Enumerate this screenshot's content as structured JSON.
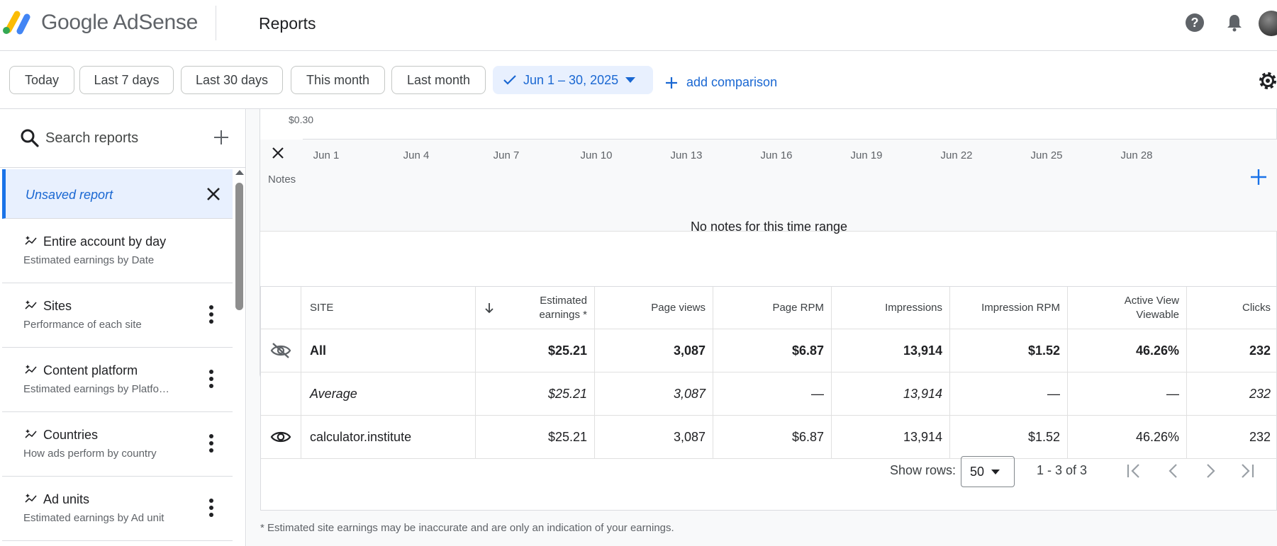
{
  "app": {
    "brand": "Google AdSense",
    "page_title": "Reports"
  },
  "date_chips": [
    "Today",
    "Last 7 days",
    "Last 30 days",
    "This month",
    "Last month"
  ],
  "date_range": {
    "selected_label": "Jun 1 – 30, 2025",
    "add_comparison": "add comparison"
  },
  "sidebar": {
    "search_placeholder": "Search reports",
    "active_report": "Unsaved report",
    "reports": [
      {
        "title": "Entire account by day",
        "subtitle": "Estimated earnings by Date"
      },
      {
        "title": "Sites",
        "subtitle": "Performance of each site"
      },
      {
        "title": "Content platform",
        "subtitle": "Estimated earnings by Platfo…"
      },
      {
        "title": "Countries",
        "subtitle": "How ads perform by country"
      },
      {
        "title": "Ad units",
        "subtitle": "Estimated earnings by Ad unit"
      }
    ]
  },
  "chart": {
    "y_tick": "$0.30",
    "x_ticks": [
      "Jun 1",
      "Jun 4",
      "Jun 7",
      "Jun 10",
      "Jun 13",
      "Jun 16",
      "Jun 19",
      "Jun 22",
      "Jun 25",
      "Jun 28"
    ]
  },
  "notes": {
    "label": "Notes",
    "empty_message": "No notes for this time range"
  },
  "table": {
    "headers": {
      "site": "SITE",
      "estimated_earnings": "Estimated earnings *",
      "page_views": "Page views",
      "page_rpm": "Page RPM",
      "impressions": "Impressions",
      "impression_rpm": "Impression RPM",
      "active_view": "Active View Viewable",
      "clicks": "Clicks"
    },
    "rows": [
      {
        "name": "All",
        "earnings": "$25.21",
        "page_views": "3,087",
        "page_rpm": "$6.87",
        "impressions": "13,914",
        "impression_rpm": "$1.52",
        "active_view": "46.26%",
        "clicks": "232"
      },
      {
        "name": "Average",
        "earnings": "$25.21",
        "page_views": "3,087",
        "page_rpm": "—",
        "impressions": "13,914",
        "impression_rpm": "—",
        "active_view": "—",
        "clicks": "232"
      },
      {
        "name": "calculator.institute",
        "earnings": "$25.21",
        "page_views": "3,087",
        "page_rpm": "$6.87",
        "impressions": "13,914",
        "impression_rpm": "$1.52",
        "active_view": "46.26%",
        "clicks": "232"
      }
    ],
    "show_rows_label": "Show rows:",
    "rows_per_page": "50",
    "range": "1 - 3 of 3"
  },
  "footnote": "* Estimated site earnings may be inaccurate and are only an indication of your earnings.",
  "colors": {
    "accent": "#1a73e8",
    "accent_text": "#1967d2",
    "selected_bg": "#e8f0fe"
  }
}
